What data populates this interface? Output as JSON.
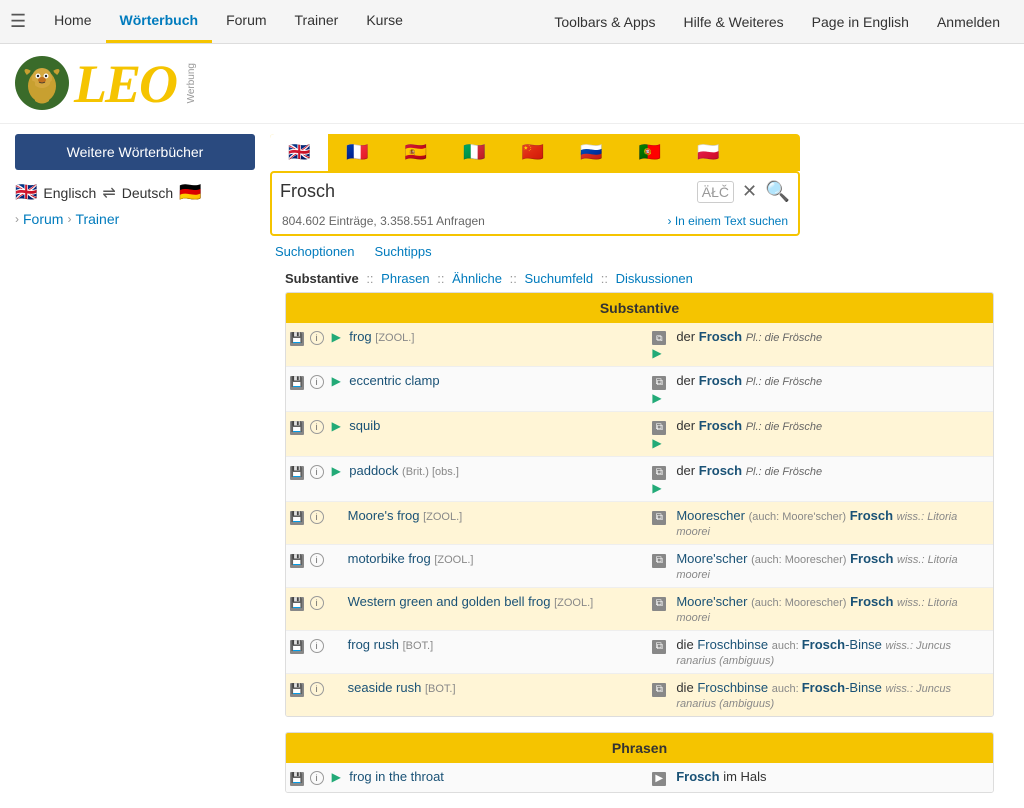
{
  "nav": {
    "hamburger": "☰",
    "items": [
      {
        "label": "Home",
        "active": false
      },
      {
        "label": "Wörterbuch",
        "active": true
      },
      {
        "label": "Forum",
        "active": false
      },
      {
        "label": "Trainer",
        "active": false
      },
      {
        "label": "Kurse",
        "active": false
      }
    ],
    "right_items": [
      {
        "label": "Toolbars & Apps"
      },
      {
        "label": "Hilfe & Weiteres"
      },
      {
        "label": "Page in English"
      },
      {
        "label": "Anmelden"
      }
    ]
  },
  "logo": {
    "text": "LEO",
    "werbung": "Werbung"
  },
  "sidebar": {
    "dict_button": "Weitere Wörterbücher",
    "lang_from": "Englisch",
    "lang_to": "Deutsch",
    "forum_link": "Forum",
    "trainer_link": "Trainer"
  },
  "search": {
    "query": "Frosch",
    "atc_label": "ÄŁČ",
    "stats": "804.602 Einträge, 3.358.551 Anfragen",
    "text_search_link": "In einem Text suchen",
    "options_label1": "Suchoptionen",
    "options_label2": "Suchtipps",
    "flags": [
      "🇬🇧",
      "🇫🇷",
      "🇪🇸",
      "🇮🇹",
      "🇨🇳",
      "🇷🇺",
      "🇵🇹",
      "🇵🇱"
    ]
  },
  "section_tabs": {
    "items": [
      "Substantive",
      "Phrasen",
      "Ähnliche",
      "Suchumfeld",
      "Diskussionen"
    ]
  },
  "substantive": {
    "header": "Substantive",
    "rows": [
      {
        "en": "frog",
        "en_tag": "[ZOOL.]",
        "en_bold": false,
        "de_art": "der",
        "de_word": "Frosch",
        "de_pl": "Pl.: die Frösche",
        "has_play_en": true,
        "has_copy_de": true,
        "has_play_de": true,
        "style": "highlighted"
      },
      {
        "en": "eccentric clamp",
        "en_tag": "",
        "en_bold": false,
        "de_art": "der",
        "de_word": "Frosch",
        "de_pl": "Pl.: die Frösche",
        "has_play_en": true,
        "has_copy_de": true,
        "has_play_de": true,
        "style": "highlighted"
      },
      {
        "en": "squib",
        "en_tag": "",
        "en_bold": false,
        "de_art": "der",
        "de_word": "Frosch",
        "de_pl": "Pl.: die Frösche",
        "has_play_en": true,
        "has_copy_de": true,
        "has_play_de": true,
        "style": "highlighted"
      },
      {
        "en": "paddock",
        "en_tag": "(Brit.) [obs.]",
        "en_bold": false,
        "de_art": "der",
        "de_word": "Frosch",
        "de_pl": "Pl.: die Frösche",
        "has_play_en": true,
        "has_copy_de": true,
        "has_play_de": true,
        "style": "highlighted"
      },
      {
        "en": "Moore's frog",
        "en_tag": "[ZOOL.]",
        "en_bold": false,
        "de_prefix": "Moorescher",
        "de_auch": "(auch: Moore'scher)",
        "de_word": "Frosch",
        "de_wiss": "wiss.: Litoria moorei",
        "has_play_en": false,
        "has_copy_de": true,
        "style": "plain"
      },
      {
        "en": "motorbike frog",
        "en_tag": "[ZOOL.]",
        "en_bold": false,
        "de_prefix": "Moore'scher",
        "de_auch": "(auch: Moorescher)",
        "de_word": "Frosch",
        "de_wiss": "wiss.: Litoria moorei",
        "has_play_en": false,
        "has_copy_de": true,
        "style": "plain"
      },
      {
        "en": "Western green and golden bell frog",
        "en_tag": "[ZOOL.]",
        "en_bold": false,
        "de_prefix": "Moore'scher",
        "de_auch": "(auch: Moorescher)",
        "de_word": "Frosch",
        "de_wiss": "wiss.: Litoria moorei",
        "has_play_en": false,
        "has_copy_de": true,
        "style": "plain"
      },
      {
        "en": "frog rush",
        "en_tag": "[BOT.]",
        "en_bold": false,
        "de_art": "die",
        "de_word": "Froschbinse",
        "de_auch": "auch:",
        "de_compound": "Frosch-Binse",
        "de_wiss": "wiss.: Juncus ranarius (ambiguus)",
        "has_play_en": false,
        "has_copy_de": true,
        "style": "plain"
      },
      {
        "en": "seaside rush",
        "en_tag": "[BOT.]",
        "en_bold": false,
        "de_art": "die",
        "de_word": "Froschbinse",
        "de_auch": "auch:",
        "de_compound": "Frosch-Binse",
        "de_wiss": "wiss.: Juncus ranarius (ambiguus)",
        "has_play_en": false,
        "has_copy_de": true,
        "style": "plain"
      }
    ]
  },
  "phrasen": {
    "header": "Phrasen",
    "rows": [
      {
        "en": "frog in the throat",
        "de_word": "Frosch",
        "de_rest": "im Hals"
      }
    ]
  }
}
